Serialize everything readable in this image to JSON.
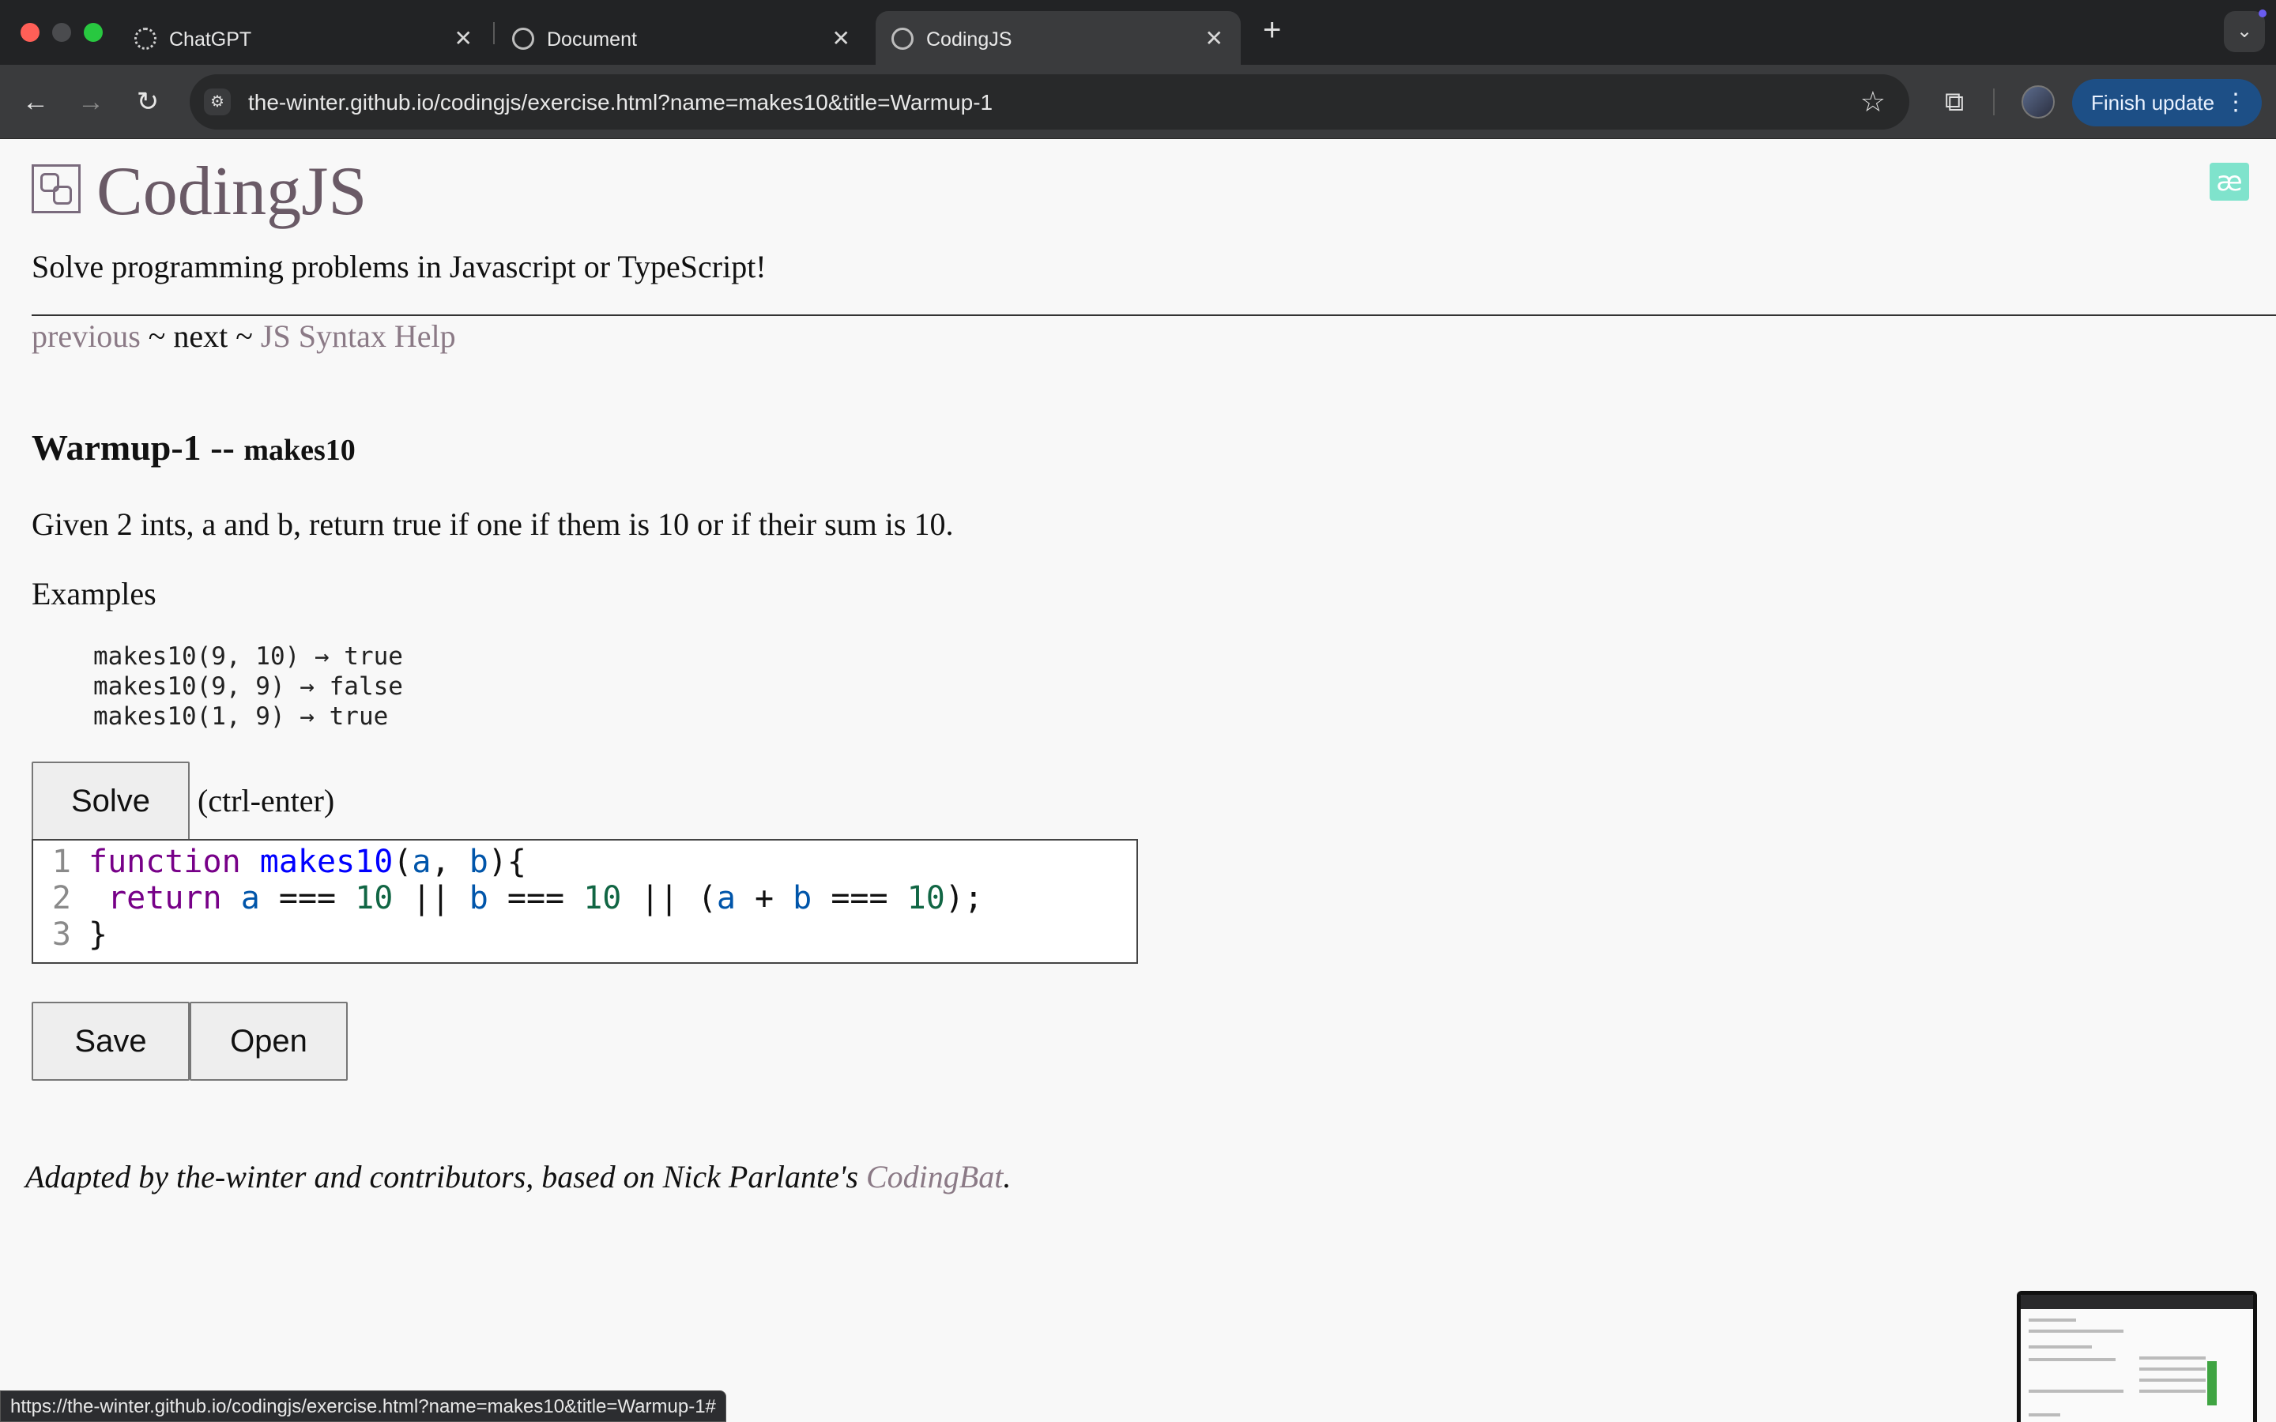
{
  "browser": {
    "tabs": [
      {
        "title": "ChatGPT",
        "icon": "chatgpt-icon"
      },
      {
        "title": "Document",
        "icon": "globe-icon"
      },
      {
        "title": "CodingJS",
        "icon": "globe-icon",
        "active": true
      }
    ],
    "url": "the-winter.github.io/codingjs/exercise.html?name=makes10&title=Warmup-1",
    "finish_update_label": "Finish update",
    "status_url": "https://the-winter.github.io/codingjs/exercise.html?name=makes10&title=Warmup-1#"
  },
  "site": {
    "brand": "CodingJS",
    "tagline": "Solve programming problems in Javascript or TypeScript!",
    "nav": {
      "previous": "previous",
      "sep1": " ~ ",
      "next": "next",
      "sep2": " ~ ",
      "help": "JS Syntax Help"
    },
    "ae_badge": "æ"
  },
  "problem": {
    "category": "Warmup-1",
    "separator": " -- ",
    "name": "makes10",
    "description": "Given 2 ints, a and b, return true if one if them is 10 or if their sum is 10.",
    "examples_label": "Examples",
    "examples": [
      "makes10(9, 10) → true",
      "makes10(9, 9) → false",
      "makes10(1, 9) → true"
    ]
  },
  "actions": {
    "solve_label": "Solve",
    "solve_hint": "(ctrl-enter)",
    "save_label": "Save",
    "open_label": "Open"
  },
  "editor": {
    "line_numbers": [
      "1",
      "2",
      "3"
    ]
  },
  "footer": {
    "text": "Adapted by the-winter and contributors, based on Nick Parlante's ",
    "link": "CodingBat",
    "end": "."
  },
  "colors": {
    "accent_link": "#8b7a86",
    "update_button": "#1d4f86"
  }
}
